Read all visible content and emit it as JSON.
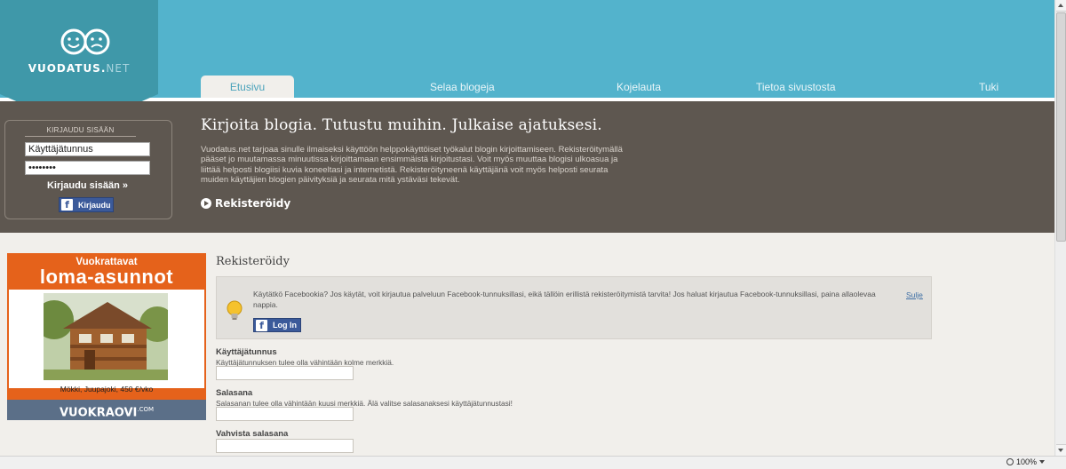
{
  "site": {
    "logo_main": "VUODATUS",
    "logo_dot": ".",
    "logo_net": "NET"
  },
  "nav": {
    "tabs": [
      {
        "label": "Etusivu",
        "active": true
      },
      {
        "label": "Selaa blogeja",
        "active": false
      },
      {
        "label": "Kojelauta",
        "active": false
      },
      {
        "label": "Tietoa sivustosta",
        "active": false
      },
      {
        "label": "Tuki",
        "active": false
      }
    ]
  },
  "login": {
    "title": "KIRJAUDU SISÄÄN",
    "username_value": "Käyttäjätunnus",
    "password_value": "••••••••",
    "submit_label": "Kirjaudu sisään »",
    "facebook_label": "Kirjaudu"
  },
  "hero": {
    "title": "Kirjoita blogia. Tutustu muihin. Julkaise ajatuksesi.",
    "description": "Vuodatus.net tarjoaa sinulle ilmaiseksi käyttöön helppokäyttöiset työkalut blogin kirjoittamiseen. Rekisteröitymällä pääset jo muutamassa minuutissa kirjoittamaan ensimmäistä kirjoitustasi. Voit myös muuttaa blogisi ulkoasua ja liittää helposti blogiisi kuvia koneeltasi ja internetistä. Rekisteröityneenä käyttäjänä voit myös helposti seurata muiden käyttäjien blogien päivityksiä ja seurata mitä ystäväsi tekevät.",
    "register_label": "Rekisteröidy"
  },
  "ad": {
    "top_text": "Vuokrattavat",
    "big_text": "loma-asunnot",
    "caption": "Mökki, Juupajoki, 450 €/vko",
    "brand": "VUOKRAOVI",
    "brand_suffix": ".COM"
  },
  "form": {
    "title": "Rekisteröidy",
    "notice_text": "Käytätkö Facebookia? Jos käytät, voit kirjautua palveluun Facebook-tunnuksillasi, eikä tällöin erillistä rekisteröitymistä tarvita! Jos haluat kirjautua Facebook-tunnuksillasi, paina allaolevaa nappia.",
    "notice_close": "Sulje",
    "fb_login_label": "Log In",
    "fields": [
      {
        "label": "Käyttäjätunnus",
        "hint": "Käyttäjätunnuksen tulee olla vähintään kolme merkkiä."
      },
      {
        "label": "Salasana",
        "hint": "Salasanan tulee olla vähintään kuusi merkkiä. Älä valitse salasanaksesi käyttäjätunnustasi!"
      },
      {
        "label": "Vahvista salasana",
        "hint": ""
      }
    ]
  },
  "status": {
    "zoom": "100%"
  },
  "colors": {
    "header_blue": "#53b3cc",
    "hero_brown": "#5e5750",
    "logo_flag": "#3f98a9",
    "facebook_blue": "#3b5a9a",
    "ad_orange": "#e5621b"
  }
}
